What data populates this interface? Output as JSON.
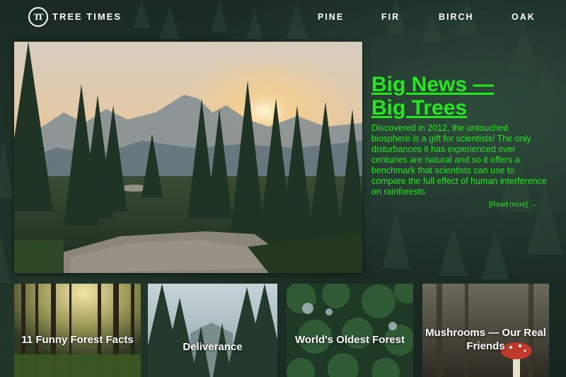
{
  "header": {
    "logo_text": "TT",
    "brand": "TREE TIMES",
    "nav": [
      {
        "label": "PINE"
      },
      {
        "label": "FIR"
      },
      {
        "label": "BIRCH"
      },
      {
        "label": "OAK"
      }
    ]
  },
  "hero": {
    "title_line1": "Big News —",
    "title_line2": "Big Trees",
    "summary": "Discovered in 2012, the untouched biosphere is a gift for scientists! The only disturbances it has experienced over centuries are natural and so it offers a benchmark that scientists can use to compare the full effect of human interference on rainforests",
    "read_more": "[Read more] →",
    "accent_color": "#22e81c"
  },
  "cards": [
    {
      "title": "11 Funny Forest Facts"
    },
    {
      "title": "Deliverance"
    },
    {
      "title": "World's Oldest Forest"
    },
    {
      "title": "Mushrooms — Our Real Friends"
    }
  ]
}
